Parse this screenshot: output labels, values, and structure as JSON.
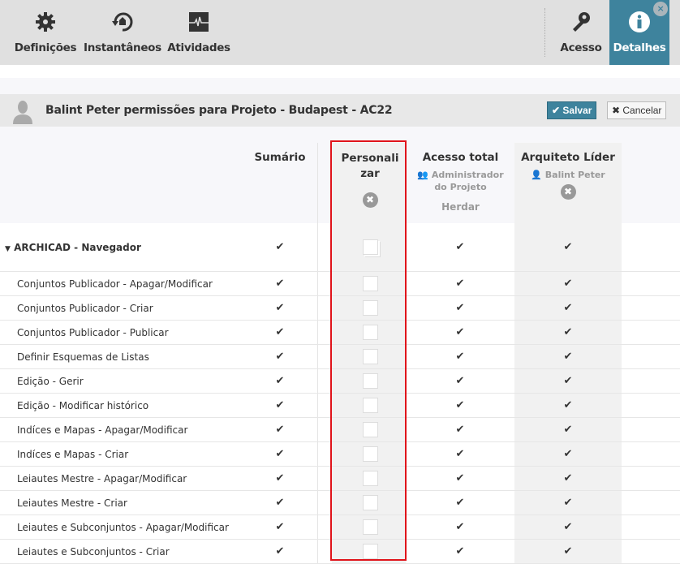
{
  "toolbar": {
    "items": [
      {
        "label": "Definições",
        "icon": "gear-icon"
      },
      {
        "label": "Instantâneos",
        "icon": "snapshot-icon"
      },
      {
        "label": "Atividades",
        "icon": "activity-icon"
      }
    ],
    "right": [
      {
        "label": "Acesso",
        "icon": "key-icon"
      },
      {
        "label": "Detalhes",
        "icon": "info-icon",
        "active": true
      }
    ],
    "close": "×"
  },
  "title": "Balint Peter permissões para Projeto - Budapest - AC22",
  "save_label": "✔ Salvar",
  "cancel_label": "✖ Cancelar",
  "columns": {
    "summary": "Sumário",
    "custom": "Personalizar",
    "full": "Acesso total",
    "full_sub": "Administrador do Projeto",
    "inherit": "Herdar",
    "lead": "Arquiteto Líder",
    "lead_sub": "Balint Peter"
  },
  "group": "ARCHICAD - Navegador",
  "check": "✔",
  "rows": [
    "Conjuntos Publicador - Apagar/Modificar",
    "Conjuntos Publicador - Criar",
    "Conjuntos Publicador - Publicar",
    "Definir Esquemas de Listas",
    "Edição - Gerir",
    "Edição - Modificar histórico",
    "Indíces e Mapas - Apagar/Modificar",
    "Indíces e Mapas - Criar",
    "Leiautes Mestre - Apagar/Modificar",
    "Leiautes Mestre - Criar",
    "Leiautes e Subconjuntos - Apagar/Modificar",
    "Leiautes e Subconjuntos - Criar"
  ]
}
